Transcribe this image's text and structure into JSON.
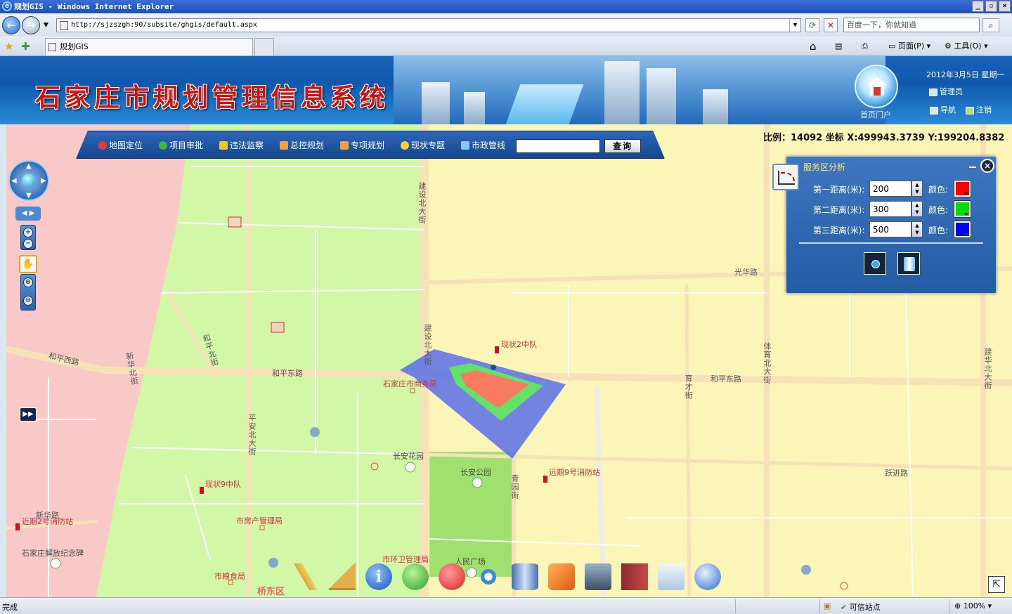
{
  "browser": {
    "window_title": "规划GIS - Windows Internet Explorer",
    "address": "http://sjzszgh:90/subsite/ghgis/default.aspx",
    "search_placeholder": "百度一下，你就知道",
    "tab_title": "规划GIS",
    "cmd_page": "页面(P)",
    "cmd_tools": "工具(O)",
    "status_done": "完成",
    "status_trusted": "可信站点",
    "zoom": "100%"
  },
  "header": {
    "system_title": "石家庄市规划管理信息系统",
    "home_label": "首页门户",
    "date": "2012年3月5日  星期一",
    "user": "管理员",
    "nav_link": "导航",
    "logout_link": "注销"
  },
  "toolbar": {
    "items": [
      {
        "label": "地图定位",
        "color": "#e23b3b"
      },
      {
        "label": "项目审批",
        "color": "#3fb34a"
      },
      {
        "label": "违法监察",
        "color": "#f2c531"
      },
      {
        "label": "总控规划",
        "color": "#f2a23a"
      },
      {
        "label": "专项规划",
        "color": "#f2a23a"
      },
      {
        "label": "现状专题",
        "color": "#f4d04a"
      },
      {
        "label": "市政管线",
        "color": "#8fc3f2"
      }
    ],
    "query_label": "查询",
    "query_value": ""
  },
  "scale_info": "比例：14092 坐标 X:499943.3739 Y:199204.8382",
  "service_panel": {
    "title": "服务区分析",
    "rows": [
      {
        "label": "第一距离(米):",
        "value": "200",
        "color_label": "颜色:",
        "color": "#ff0000"
      },
      {
        "label": "第二距离(米):",
        "value": "300",
        "color_label": "颜色:",
        "color": "#00dd00"
      },
      {
        "label": "第三距离(米):",
        "value": "500",
        "color_label": "颜色:",
        "color": "#0000ff"
      }
    ]
  },
  "map": {
    "road_labels": [
      {
        "text": "建设北大街"
      },
      {
        "text": "光华路"
      },
      {
        "text": "和平西路"
      },
      {
        "text": "和平东路"
      },
      {
        "text": "建设北大街"
      },
      {
        "text": "和平东路"
      },
      {
        "text": "育才街"
      },
      {
        "text": "体育北大街"
      },
      {
        "text": "建华北大街"
      },
      {
        "text": "跃进路"
      },
      {
        "text": "平安北大街"
      },
      {
        "text": "新华路"
      },
      {
        "text": "青园街"
      },
      {
        "text": "和平北街"
      },
      {
        "text": "新华北街"
      }
    ],
    "poi_labels": [
      {
        "text": "现状2中队",
        "kind": "red"
      },
      {
        "text": "石家庄市商务局",
        "kind": "red"
      },
      {
        "text": "长安花园",
        "kind": "dark"
      },
      {
        "text": "长安公园",
        "kind": "dark"
      },
      {
        "text": "远期9号消防站",
        "kind": "red"
      },
      {
        "text": "现状9中队",
        "kind": "red"
      },
      {
        "text": "近期2号消防站",
        "kind": "red"
      },
      {
        "text": "市房产管理局",
        "kind": "red"
      },
      {
        "text": "石家庄解放纪念碑",
        "kind": "dark"
      },
      {
        "text": "市环卫管理局",
        "kind": "red"
      },
      {
        "text": "人民广场",
        "kind": "dark"
      },
      {
        "text": "市粮食局",
        "kind": "red"
      },
      {
        "text": "桥东区",
        "kind": "red"
      }
    ]
  }
}
